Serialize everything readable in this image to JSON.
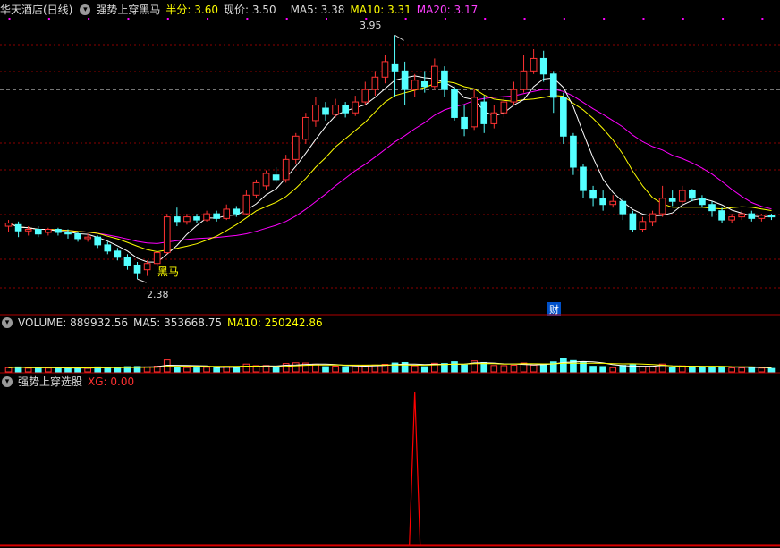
{
  "main_header": {
    "stock": "华天酒店(日线)",
    "indicator": "强势上穿黑马",
    "half_label": "半分:",
    "half_value": "3.60",
    "price_label": "现价:",
    "price_value": "3.50",
    "ma5_label": "MA5:",
    "ma5_value": "3.38",
    "ma10_label": "MA10:",
    "ma10_value": "3.31",
    "ma20_label": "MA20:",
    "ma20_value": "3.17"
  },
  "annotations": {
    "high_label": "3.95",
    "low_label": "2.38",
    "signal_label": "黑马",
    "cai_label": "财"
  },
  "volume_header": {
    "label": "VOLUME:",
    "value": "889932.56",
    "ma5_label": "MA5:",
    "ma5_value": "353668.75",
    "ma10_label": "MA10:",
    "ma10_value": "250242.86"
  },
  "xg_header": {
    "title": "强势上穿选股",
    "xg_label": "XG:",
    "xg_value": "0.00"
  },
  "colors": {
    "up": "#ff3232",
    "down": "#54ffff",
    "ma5": "#ffffff",
    "ma10": "#ffff00",
    "ma20": "#ff00ff",
    "grid": "#8b0000"
  },
  "chart_data": {
    "type": "candlestick",
    "series_names": [
      "MA5",
      "MA10",
      "MA20"
    ],
    "high_mark": 3.95,
    "low_mark": 2.38,
    "ylim": [
      2.3,
      4.05
    ],
    "xg_signal_index": 41,
    "candles": [
      [
        2.72,
        2.74,
        2.76,
        2.68
      ],
      [
        2.73,
        2.69,
        2.75,
        2.65
      ],
      [
        2.69,
        2.7,
        2.72,
        2.66
      ],
      [
        2.7,
        2.67,
        2.72,
        2.65
      ],
      [
        2.68,
        2.7,
        2.71,
        2.66
      ],
      [
        2.7,
        2.68,
        2.71,
        2.66
      ],
      [
        2.68,
        2.67,
        2.7,
        2.64
      ],
      [
        2.67,
        2.64,
        2.68,
        2.62
      ],
      [
        2.64,
        2.65,
        2.67,
        2.62
      ],
      [
        2.65,
        2.6,
        2.66,
        2.58
      ],
      [
        2.6,
        2.56,
        2.62,
        2.54
      ],
      [
        2.56,
        2.52,
        2.58,
        2.5
      ],
      [
        2.52,
        2.47,
        2.54,
        2.44
      ],
      [
        2.47,
        2.42,
        2.49,
        2.38
      ],
      [
        2.44,
        2.48,
        2.5,
        2.4
      ],
      [
        2.48,
        2.55,
        2.56,
        2.46
      ],
      [
        2.55,
        2.78,
        2.8,
        2.54
      ],
      [
        2.78,
        2.75,
        2.84,
        2.72
      ],
      [
        2.75,
        2.78,
        2.8,
        2.73
      ],
      [
        2.78,
        2.76,
        2.8,
        2.74
      ],
      [
        2.76,
        2.8,
        2.82,
        2.75
      ],
      [
        2.8,
        2.77,
        2.82,
        2.75
      ],
      [
        2.77,
        2.83,
        2.86,
        2.76
      ],
      [
        2.83,
        2.8,
        2.85,
        2.78
      ],
      [
        2.8,
        2.92,
        2.95,
        2.79
      ],
      [
        2.92,
        3.0,
        3.02,
        2.9
      ],
      [
        2.98,
        3.06,
        3.08,
        2.95
      ],
      [
        3.05,
        3.02,
        3.1,
        3.0
      ],
      [
        3.02,
        3.15,
        3.18,
        3.0
      ],
      [
        3.15,
        3.3,
        3.32,
        3.12
      ],
      [
        3.28,
        3.42,
        3.45,
        3.25
      ],
      [
        3.4,
        3.5,
        3.55,
        3.36
      ],
      [
        3.48,
        3.44,
        3.52,
        3.4
      ],
      [
        3.44,
        3.5,
        3.54,
        3.42
      ],
      [
        3.5,
        3.45,
        3.52,
        3.42
      ],
      [
        3.45,
        3.52,
        3.56,
        3.43
      ],
      [
        3.52,
        3.6,
        3.65,
        3.5
      ],
      [
        3.6,
        3.68,
        3.72,
        3.56
      ],
      [
        3.68,
        3.78,
        3.82,
        3.64
      ],
      [
        3.76,
        3.72,
        3.95,
        3.55
      ],
      [
        3.72,
        3.6,
        3.78,
        3.5
      ],
      [
        3.6,
        3.66,
        3.7,
        3.55
      ],
      [
        3.65,
        3.62,
        3.72,
        3.58
      ],
      [
        3.62,
        3.75,
        3.8,
        3.6
      ],
      [
        3.72,
        3.6,
        3.75,
        3.55
      ],
      [
        3.6,
        3.42,
        3.62,
        3.4
      ],
      [
        3.42,
        3.35,
        3.5,
        3.3
      ],
      [
        3.36,
        3.55,
        3.6,
        3.34
      ],
      [
        3.52,
        3.38,
        3.56,
        3.32
      ],
      [
        3.38,
        3.45,
        3.5,
        3.35
      ],
      [
        3.45,
        3.52,
        3.56,
        3.42
      ],
      [
        3.52,
        3.6,
        3.65,
        3.5
      ],
      [
        3.6,
        3.72,
        3.82,
        3.58
      ],
      [
        3.72,
        3.8,
        3.86,
        3.7
      ],
      [
        3.8,
        3.7,
        3.85,
        3.65
      ],
      [
        3.7,
        3.55,
        3.72,
        3.45
      ],
      [
        3.55,
        3.3,
        3.58,
        3.25
      ],
      [
        3.3,
        3.1,
        3.32,
        3.05
      ],
      [
        3.1,
        2.95,
        3.12,
        2.9
      ],
      [
        2.95,
        2.9,
        2.98,
        2.85
      ],
      [
        2.9,
        2.86,
        2.95,
        2.82
      ],
      [
        2.86,
        2.88,
        2.92,
        2.84
      ],
      [
        2.88,
        2.8,
        2.9,
        2.76
      ],
      [
        2.8,
        2.7,
        2.82,
        2.68
      ],
      [
        2.7,
        2.75,
        2.78,
        2.68
      ],
      [
        2.75,
        2.8,
        2.82,
        2.72
      ],
      [
        2.8,
        2.9,
        2.98,
        2.78
      ],
      [
        2.9,
        2.88,
        2.95,
        2.85
      ],
      [
        2.88,
        2.95,
        2.98,
        2.86
      ],
      [
        2.95,
        2.9,
        2.96,
        2.88
      ],
      [
        2.9,
        2.86,
        2.92,
        2.84
      ],
      [
        2.86,
        2.82,
        2.88,
        2.78
      ],
      [
        2.82,
        2.76,
        2.84,
        2.74
      ],
      [
        2.76,
        2.78,
        2.8,
        2.74
      ],
      [
        2.78,
        2.8,
        2.82,
        2.76
      ],
      [
        2.8,
        2.77,
        2.82,
        2.75
      ],
      [
        2.77,
        2.79,
        2.8,
        2.75
      ],
      [
        2.79,
        2.78,
        2.8,
        2.76
      ]
    ]
  }
}
